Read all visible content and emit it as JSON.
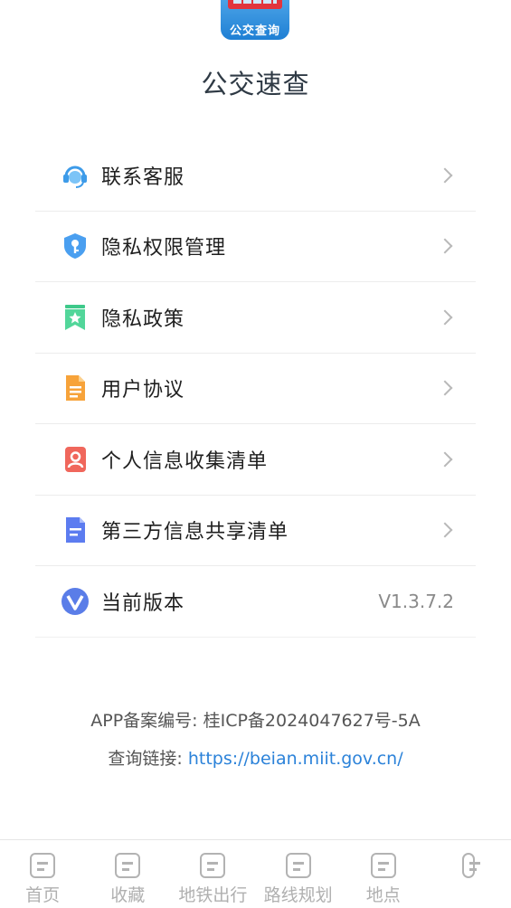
{
  "app": {
    "logo_text": "公交查询",
    "name": "公交速查"
  },
  "menu": {
    "items": [
      {
        "label": "联系客服",
        "icon": "customer-service-icon"
      },
      {
        "label": "隐私权限管理",
        "icon": "shield-key-icon"
      },
      {
        "label": "隐私政策",
        "icon": "bookmark-star-icon"
      },
      {
        "label": "用户协议",
        "icon": "document-icon"
      },
      {
        "label": "个人信息收集清单",
        "icon": "person-card-icon"
      },
      {
        "label": "第三方信息共享清单",
        "icon": "file-share-icon"
      },
      {
        "label": "当前版本",
        "icon": "version-v-icon",
        "value": "V1.3.7.2"
      }
    ]
  },
  "footer": {
    "record": "APP备案编号: 桂ICP备2024047627号-5A",
    "link_prefix": "查询链接: ",
    "link_url": "https://beian.miit.gov.cn/"
  },
  "tabs": [
    {
      "label": "首页"
    },
    {
      "label": "收藏"
    },
    {
      "label": "地铁出行"
    },
    {
      "label": "路线规划"
    },
    {
      "label": "地点"
    },
    {
      "label": ""
    }
  ],
  "colors": {
    "link": "#2b82d9",
    "text": "#1f1f1f",
    "muted": "#8a8a8a"
  }
}
